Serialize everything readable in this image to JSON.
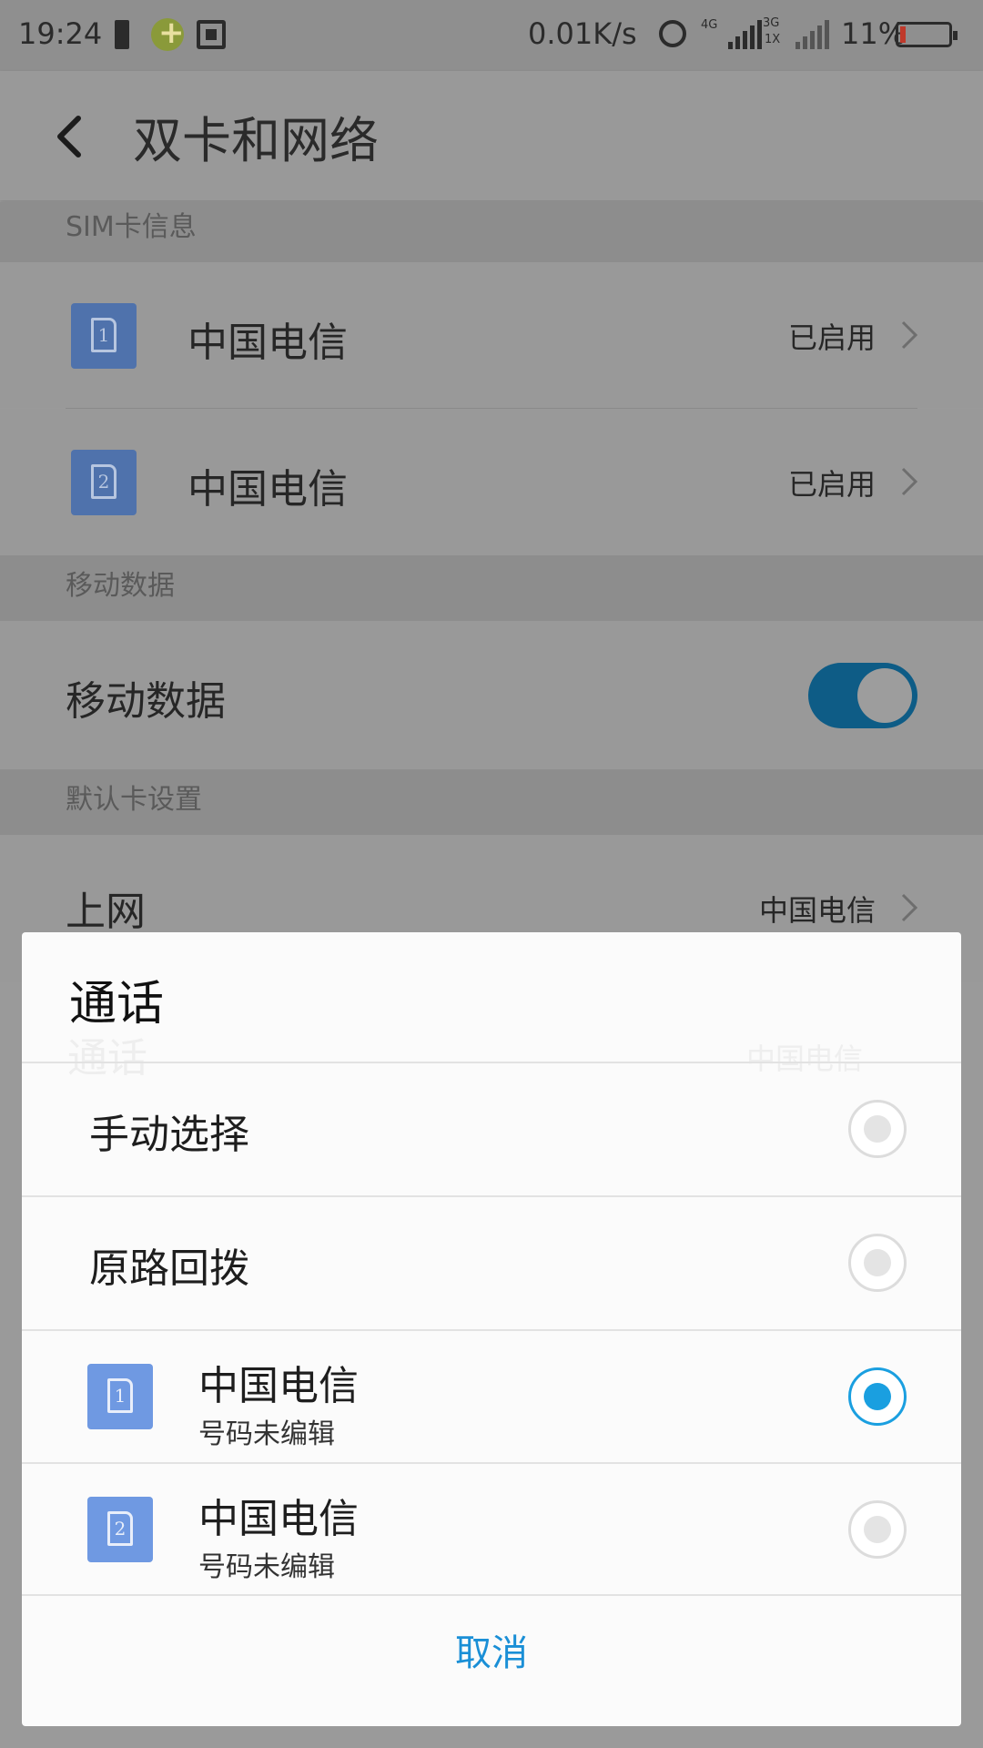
{
  "status_bar": {
    "time": "19:24",
    "net_speed": "0.01K/s",
    "net_type_1": "4G",
    "net_type_2": "3G",
    "net_type_3": "1X",
    "battery_percent": "11%",
    "battery_level": 0.11,
    "battery_color": "#c0392b",
    "icons": [
      "battery-saver-icon",
      "app-notification-icon",
      "screenshot-icon",
      "alarm-icon",
      "signal-icon",
      "signal-icon",
      "battery-icon"
    ]
  },
  "header": {
    "title": "双卡和网络",
    "back_icon": "chevron-left-icon"
  },
  "sections": {
    "sim_info": "SIM卡信息",
    "mobile_data": "移动数据",
    "default_card": "默认卡设置"
  },
  "sim_cards": [
    {
      "slot": "1",
      "name": "中国电信",
      "status": "已启用"
    },
    {
      "slot": "2",
      "name": "中国电信",
      "status": "已启用"
    }
  ],
  "mobile_data": {
    "label": "移动数据",
    "enabled": true
  },
  "default_settings": {
    "internet_label": "上网",
    "internet_value": "中国电信",
    "call_label": "通话",
    "call_value": "中国电信"
  },
  "dialog": {
    "title": "通话",
    "options": [
      {
        "label": "手动选择",
        "checked": false
      },
      {
        "label": "原路回拨",
        "checked": false
      }
    ],
    "sim_options": [
      {
        "slot": "1",
        "name": "中国电信",
        "number": "号码未编辑",
        "checked": true
      },
      {
        "slot": "2",
        "name": "中国电信",
        "number": "号码未编辑",
        "checked": false
      }
    ],
    "cancel_label": "取消"
  },
  "colors": {
    "accent": "#1a9fe0",
    "toggle_on": "#0e5c86",
    "sim_badge": "#6f99e2"
  }
}
